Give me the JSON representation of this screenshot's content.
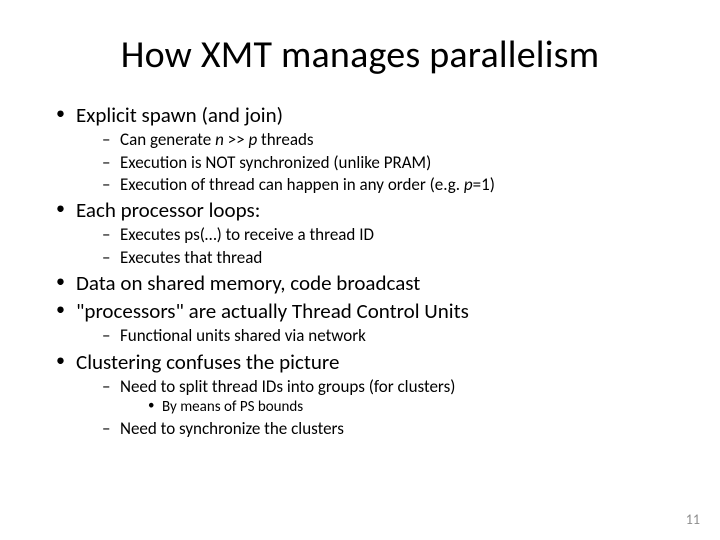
{
  "title": "How XMT manages parallelism",
  "b1": {
    "label": "Explicit spawn (and join)",
    "s1_pre": "Can generate ",
    "s1_n": "n",
    "s1_mid": " >> ",
    "s1_p": "p",
    "s1_post": " threads",
    "s2": "Execution is NOT synchronized (unlike PRAM)",
    "s3_pre": "Execution of thread can happen in any order (e.g. ",
    "s3_p": "p",
    "s3_post": "=1)"
  },
  "b2": {
    "label": "Each processor loops:",
    "s1": "Executes ps(…) to receive a thread ID",
    "s2": "Executes that thread"
  },
  "b3": {
    "label": "Data on shared memory, code broadcast"
  },
  "b4": {
    "label": "\"processors\" are actually Thread Control Units",
    "s1": "Functional units shared via network"
  },
  "b5": {
    "label": "Clustering confuses the picture",
    "s1": "Need to split thread IDs into groups (for clusters)",
    "s1_1": "By means of PS bounds",
    "s2": "Need to synchronize the clusters"
  },
  "pagenum": "11"
}
